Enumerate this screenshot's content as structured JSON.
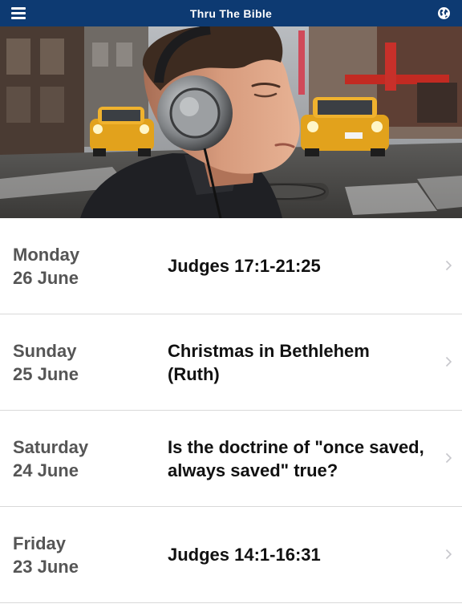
{
  "header": {
    "title": "Thru The Bible",
    "menu_icon": "hamburger-menu-icon",
    "language_icon": "globe-icon",
    "background_color": "#0d3a72"
  },
  "hero": {
    "image": "man-with-headphones-city-street-photo"
  },
  "episodes": [
    {
      "day": "Monday",
      "date": "26 June",
      "title": "Judges 17:1-21:25"
    },
    {
      "day": "Sunday",
      "date": "25 June",
      "title": "Christmas in Bethlehem (Ruth)"
    },
    {
      "day": "Saturday",
      "date": "24 June",
      "title": "Is the doctrine of \"once saved, always saved\" true?"
    },
    {
      "day": "Friday",
      "date": "23 June",
      "title": "Judges 14:1-16:31"
    }
  ]
}
